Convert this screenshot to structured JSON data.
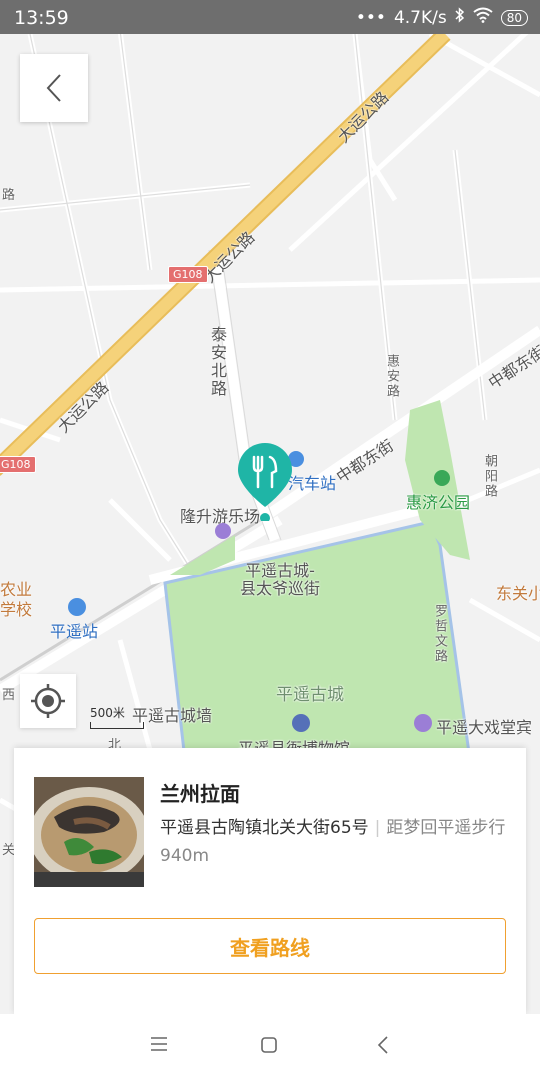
{
  "status_bar": {
    "time": "13:59",
    "dots": "•••",
    "speed": "4.7K/s",
    "battery": "80"
  },
  "map": {
    "roads": {
      "dayun_1": "大运公路",
      "dayun_2": "大运公路",
      "dayun_3": "大运公路",
      "taian": "泰安北路",
      "huian": "惠安路",
      "zhongdu_1": "中都东街",
      "zhongdu_2": "中都东街",
      "chaoyang": "朝阳路",
      "luozhe": "罗哲文路",
      "left_lu": "路",
      "left_xi": "西",
      "left_bei": "北",
      "left_guan": "关"
    },
    "g108_a": "G108",
    "g108_b": "G108",
    "pois": {
      "bus_station": "汽车站",
      "longsheng": "隆升游乐场",
      "pingyao_gucheng_sign": "平遥古城-\n县太爷巡街",
      "pingyao_station": "平遥站",
      "huiji_park": "惠济公园",
      "gucheng": "平遥古城",
      "gucheng_wall": "平遥古城墙",
      "museum": "平遥县衙博物馆",
      "theater": "平遥大戏堂宾",
      "dongguan": "东关小",
      "school": "农业\n学校"
    },
    "scale_label": "500米"
  },
  "card": {
    "title": "兰州拉面",
    "address": "平遥县古陶镇北关大街65号",
    "distance": "距梦回平遥步行940m",
    "route_button": "查看路线"
  },
  "icons": {
    "back": "chevron-left-icon",
    "locate": "locate-icon",
    "pin": "restaurant-pin-icon",
    "menu": "menu-icon",
    "home": "home-icon",
    "nav_back": "nav-back-icon"
  },
  "colors": {
    "main_road": "#f5d27a",
    "park": "#bfe6b0",
    "pin": "#1fb5a6",
    "accent": "#f0a020"
  }
}
